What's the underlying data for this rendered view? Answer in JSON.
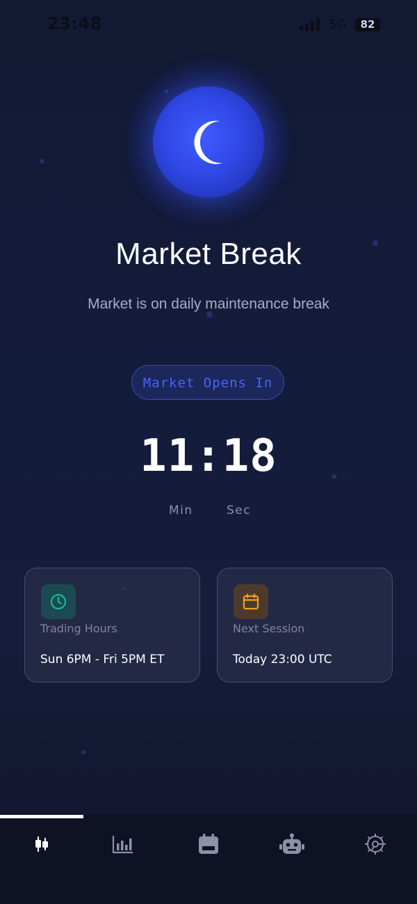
{
  "status_bar": {
    "time": "23:48",
    "network": "5G",
    "battery": "82"
  },
  "main": {
    "icon": "moon-icon",
    "title": "Market Break",
    "subtitle": "Market is on daily maintenance break",
    "opens_label": "Market Opens In",
    "countdown": "11:18",
    "units": {
      "minutes": "Min",
      "seconds": "Sec"
    }
  },
  "cards": [
    {
      "icon": "clock-icon",
      "label": "Trading Hours",
      "value": "Sun 6PM - Fri 5PM ET",
      "accent": "#16b79a"
    },
    {
      "icon": "calendar-icon",
      "label": "Next Session",
      "value": "Today 23:00 UTC",
      "accent": "#f5a11a"
    }
  ],
  "nav": {
    "active_index": 0,
    "items": [
      {
        "icon": "candlestick-icon"
      },
      {
        "icon": "bar-chart-icon"
      },
      {
        "icon": "calendar-icon"
      },
      {
        "icon": "robot-icon"
      },
      {
        "icon": "settings-icon"
      }
    ]
  }
}
